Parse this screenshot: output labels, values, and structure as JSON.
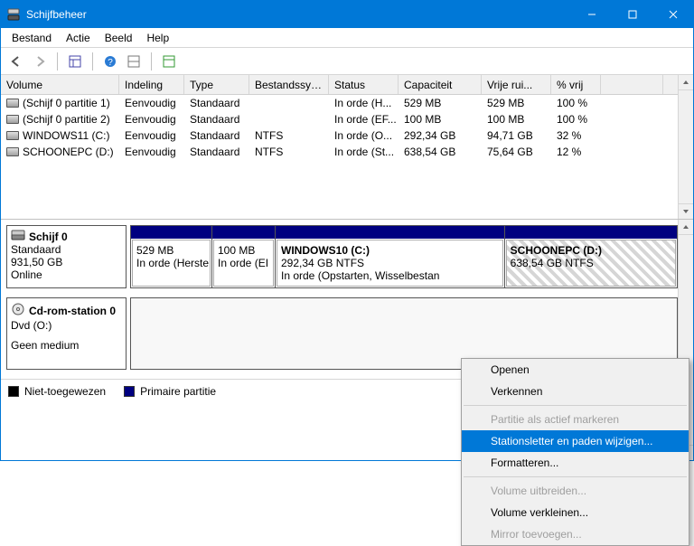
{
  "title": "Schijfbeheer",
  "menus": {
    "file": "Bestand",
    "action": "Actie",
    "view": "Beeld",
    "help": "Help"
  },
  "columns": [
    "Volume",
    "Indeling",
    "Type",
    "Bestandssys...",
    "Status",
    "Capaciteit",
    "Vrije rui...",
    "% vrij",
    ""
  ],
  "volumes": [
    {
      "name": "(Schijf 0 partitie 1)",
      "layout": "Eenvoudig",
      "type": "Standaard",
      "fs": "",
      "status": "In orde (H...",
      "capacity": "529 MB",
      "free": "529 MB",
      "pct": "100 %"
    },
    {
      "name": "(Schijf 0 partitie 2)",
      "layout": "Eenvoudig",
      "type": "Standaard",
      "fs": "",
      "status": "In orde (EF...",
      "capacity": "100 MB",
      "free": "100 MB",
      "pct": "100 %"
    },
    {
      "name": "WINDOWS11 (C:)",
      "layout": "Eenvoudig",
      "type": "Standaard",
      "fs": "NTFS",
      "status": "In orde (O...",
      "capacity": "292,34 GB",
      "free": "94,71 GB",
      "pct": "32 %"
    },
    {
      "name": "SCHOONEPC (D:)",
      "layout": "Eenvoudig",
      "type": "Standaard",
      "fs": "NTFS",
      "status": "In orde (St...",
      "capacity": "638,54 GB",
      "free": "75,64 GB",
      "pct": "12 %"
    }
  ],
  "disk0": {
    "title": "Schijf 0",
    "type": "Standaard",
    "size": "931,50 GB",
    "state": "Online",
    "p1": {
      "size": "529 MB",
      "status": "In orde (Herste"
    },
    "p2": {
      "size": "100 MB",
      "status": "In orde (EI"
    },
    "p3": {
      "title": "WINDOWS10  (C:)",
      "size": "292,34 GB NTFS",
      "status": "In orde (Opstarten, Wisselbestan"
    },
    "p4": {
      "title": "SCHOONEPC  (D:)",
      "size": "638,54 GB NTFS"
    }
  },
  "cdrom": {
    "title": "Cd-rom-station 0",
    "type": "Dvd (O:)",
    "state": "Geen medium"
  },
  "legend": {
    "unalloc": "Niet-toegewezen",
    "primary": "Primaire partitie"
  },
  "ctx": {
    "open": "Openen",
    "explore": "Verkennen",
    "markactive": "Partitie als actief markeren",
    "driveletter": "Stationsletter en paden wijzigen...",
    "format": "Formatteren...",
    "extend": "Volume uitbreiden...",
    "shrink": "Volume verkleinen...",
    "mirror": "Mirror toevoegen..."
  }
}
